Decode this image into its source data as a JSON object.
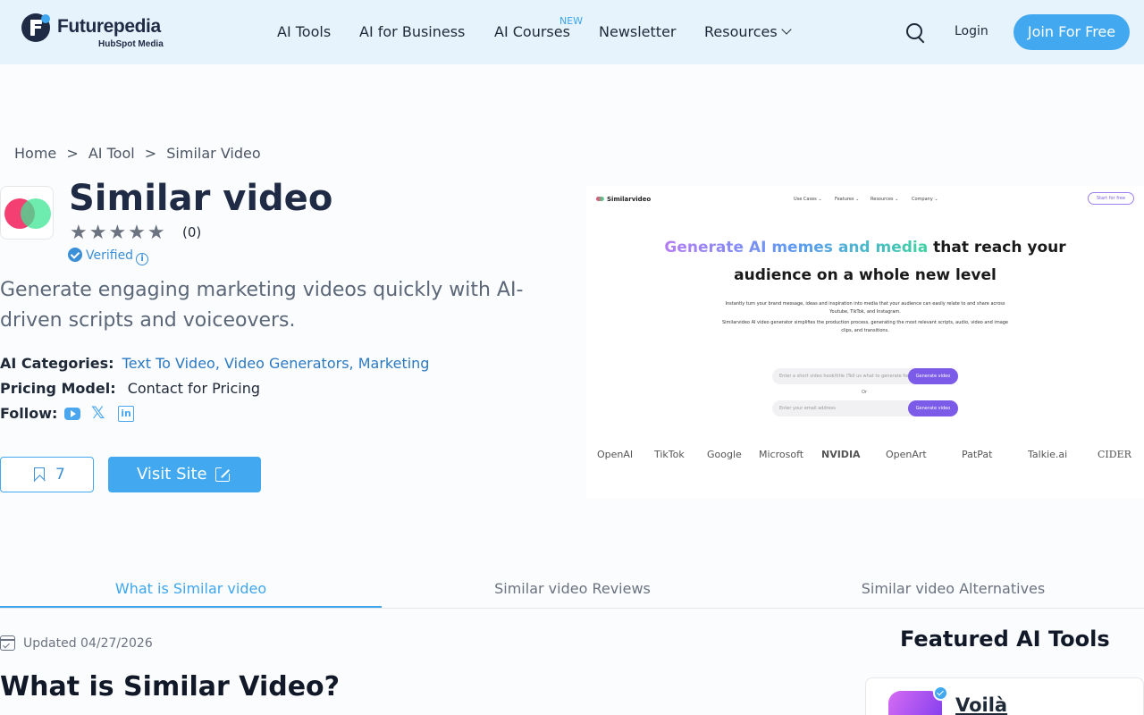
{
  "header": {
    "brand": "Futurepedia",
    "brand_sub": "HubSpot Media",
    "nav": [
      "AI Tools",
      "AI for Business",
      "AI Courses",
      "Newsletter",
      "Resources"
    ],
    "new_badge": "NEW",
    "login": "Login",
    "join": "Join For Free"
  },
  "breadcrumb": [
    "Home",
    ">",
    "AI Tool",
    ">",
    "Similar Video"
  ],
  "tool": {
    "name": "Similar video",
    "stars": "★★★★★",
    "rating_count": "(0)",
    "verified": "Verified",
    "tagline": "Generate engaging marketing videos quickly with AI-driven scripts and voiceovers.",
    "categories_label": "AI Categories:",
    "categories": [
      "Text To Video,",
      "Video Generators,",
      "Marketing"
    ],
    "pricing_label": "Pricing Model:",
    "pricing": "Contact for Pricing",
    "follow_label": "Follow:",
    "save_count": "7",
    "visit": "Visit Site"
  },
  "preview": {
    "logo": "Similarvideo",
    "nav": [
      "Use Cases ⌄",
      "Features ⌄",
      "Resources ⌄",
      "Company ⌄"
    ],
    "start": "Start for free",
    "headline_grad": "Generate AI memes and media",
    "headline_rest": " that reach your",
    "headline_line2": "audience on a whole new level",
    "para1": "Instantly turn your brand message, ideas and inspiration into media that your audience can easily relate to and share across Youtube, TikTok, and Instagram.",
    "para2": "Similarvideo AI video generator simplifies the production process, generating the most relevant scripts, audio, video and image clips, and transitions.",
    "input1": "Enter a short video hook/title (Tell us what to generate for ...)",
    "input2": "Enter your email address",
    "generate": "Generate video",
    "or": "Or",
    "brands": [
      "OpenAI",
      "TikTok",
      "Google",
      "Microsoft",
      "NVIDIA",
      "OpenArt",
      "PatPat",
      "Talkie.ai",
      "CIDER"
    ]
  },
  "tabs": [
    "What is Similar video",
    "Similar video Reviews",
    "Similar video Alternatives"
  ],
  "content": {
    "updated": "Updated 04/27/2026",
    "title": "What is Similar Video?"
  },
  "featured": {
    "title": "Featured AI Tools",
    "item": "Voilà"
  },
  "colors": {
    "accent": "#42a9f0",
    "header_bg": "#e6f3fd",
    "link": "#2b79c2"
  }
}
